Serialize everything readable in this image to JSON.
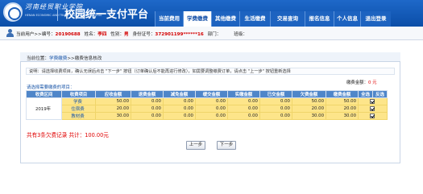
{
  "header": {
    "school_name": "河南经贸职业学院",
    "school_name_en": "HENAN ECONOMIC AND TRADE VOCATIONAL COLLEGE",
    "platform_title": "校园统一支付平台",
    "nav": [
      "当前费用",
      "学费缴费",
      "其他缴费",
      "生活缴费",
      "交易查询",
      "报名信息",
      "个人信息",
      "退出登录"
    ],
    "active_nav": "学费缴费"
  },
  "userbar": {
    "current_user_label": "当前用户>>",
    "id_label": "编号：",
    "id_value": "20190688",
    "name_label": "姓名：",
    "name_value": "李四",
    "gender_label": "性别：",
    "gender_value": "男",
    "idcard_label": "身份证号：",
    "idcard_value": "372901199******16",
    "dept_label": "部门：",
    "dept_value": "",
    "class_label": "班级：",
    "class_value": ""
  },
  "breadcrumb": {
    "prefix": "当前位置：",
    "part1": "学费缴费",
    "separator": ">>",
    "part2": "缴费信息核改"
  },
  "note": "说明：请选择收费项目，确认无误后点击 \"下一步\" 按钮（订单确认后不能再进行修改），如需要调整缴费订单，请点击 \"上一步\" 按钮重新选择",
  "fee": {
    "label": "缴费金额：",
    "amount": "0 元"
  },
  "select_label": "请选择需要缴费的项目：",
  "table": {
    "headers": [
      "收费区间",
      "收费项目",
      "应收金额",
      "退费金额",
      "减免金额",
      "缓交金额",
      "实缴金额",
      "已交金额",
      "欠费金额",
      "缴费金额",
      "全选",
      "反选"
    ],
    "year": "2019年",
    "rows": [
      {
        "item": "学费",
        "due": "50.00",
        "refund": "0.00",
        "waive": "0.00",
        "defer": "0.00",
        "actual": "0.00",
        "paid": "0.00",
        "owed": "50.00",
        "pay": "50.00",
        "checked": true
      },
      {
        "item": "住宿费",
        "due": "20.00",
        "refund": "0.00",
        "waive": "0.00",
        "defer": "0.00",
        "actual": "0.00",
        "paid": "0.00",
        "owed": "20.00",
        "pay": "20.00",
        "checked": true
      },
      {
        "item": "教材费",
        "due": "30.00",
        "refund": "0.00",
        "waive": "0.00",
        "defer": "0.00",
        "actual": "0.00",
        "paid": "0.00",
        "owed": "30.00",
        "pay": "30.00",
        "checked": true
      }
    ]
  },
  "summary": "共有3条欠费记录 共计：100.00元",
  "buttons": {
    "prev": "上一步",
    "next": "下一步"
  }
}
